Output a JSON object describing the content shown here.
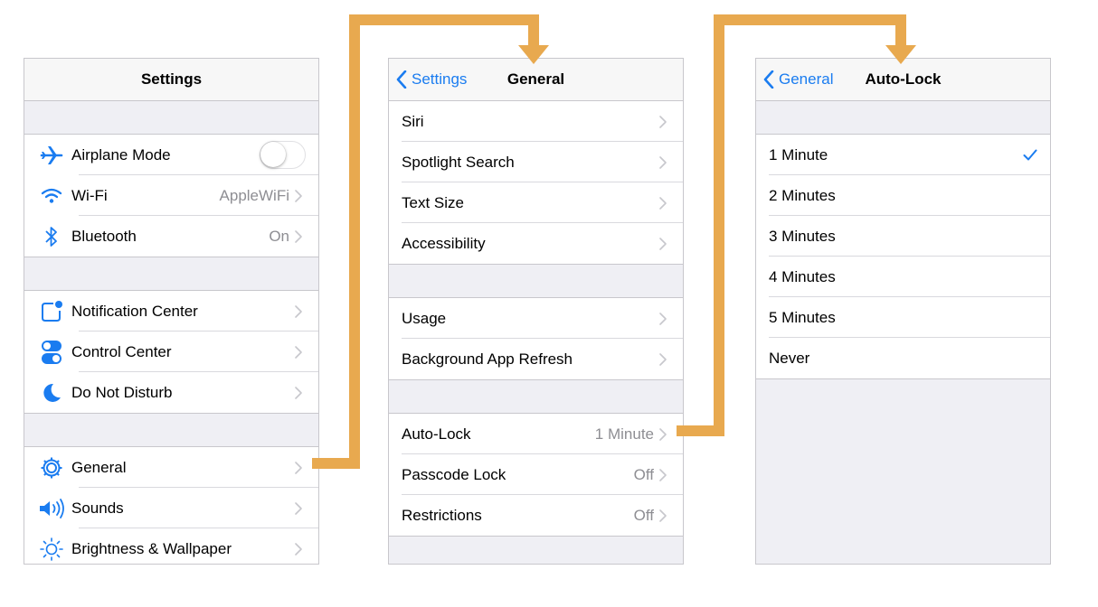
{
  "settings_panel": {
    "title": "Settings",
    "groups": [
      [
        {
          "icon": "airplane-icon",
          "label": "Airplane Mode",
          "control": "switch",
          "switch_on": false
        },
        {
          "icon": "wifi-icon",
          "label": "Wi-Fi",
          "detail": "AppleWiFi"
        },
        {
          "icon": "bluetooth-icon",
          "label": "Bluetooth",
          "detail": "On"
        }
      ],
      [
        {
          "icon": "notification-center-icon",
          "label": "Notification Center"
        },
        {
          "icon": "control-center-icon",
          "label": "Control Center"
        },
        {
          "icon": "moon-icon",
          "label": "Do Not Disturb"
        }
      ],
      [
        {
          "icon": "gear-icon",
          "label": "General"
        },
        {
          "icon": "speaker-icon",
          "label": "Sounds"
        },
        {
          "icon": "sun-icon",
          "label": "Brightness & Wallpaper"
        }
      ]
    ]
  },
  "general_panel": {
    "back_label": "Settings",
    "title": "General",
    "groups": [
      [
        {
          "label": "Siri"
        },
        {
          "label": "Spotlight Search"
        },
        {
          "label": "Text Size"
        },
        {
          "label": "Accessibility"
        }
      ],
      [
        {
          "label": "Usage"
        },
        {
          "label": "Background App Refresh"
        }
      ],
      [
        {
          "label": "Auto-Lock",
          "detail": "1 Minute"
        },
        {
          "label": "Passcode Lock",
          "detail": "Off"
        },
        {
          "label": "Restrictions",
          "detail": "Off"
        }
      ]
    ]
  },
  "autolock_panel": {
    "back_label": "General",
    "title": "Auto-Lock",
    "options": [
      "1 Minute",
      "2 Minutes",
      "3 Minutes",
      "4 Minutes",
      "5 Minutes",
      "Never"
    ],
    "selected": "1 Minute"
  },
  "colors": {
    "ios_blue": "#1a7cf0",
    "arrow_orange": "#e8a94f",
    "group_bg": "#efeff4"
  }
}
